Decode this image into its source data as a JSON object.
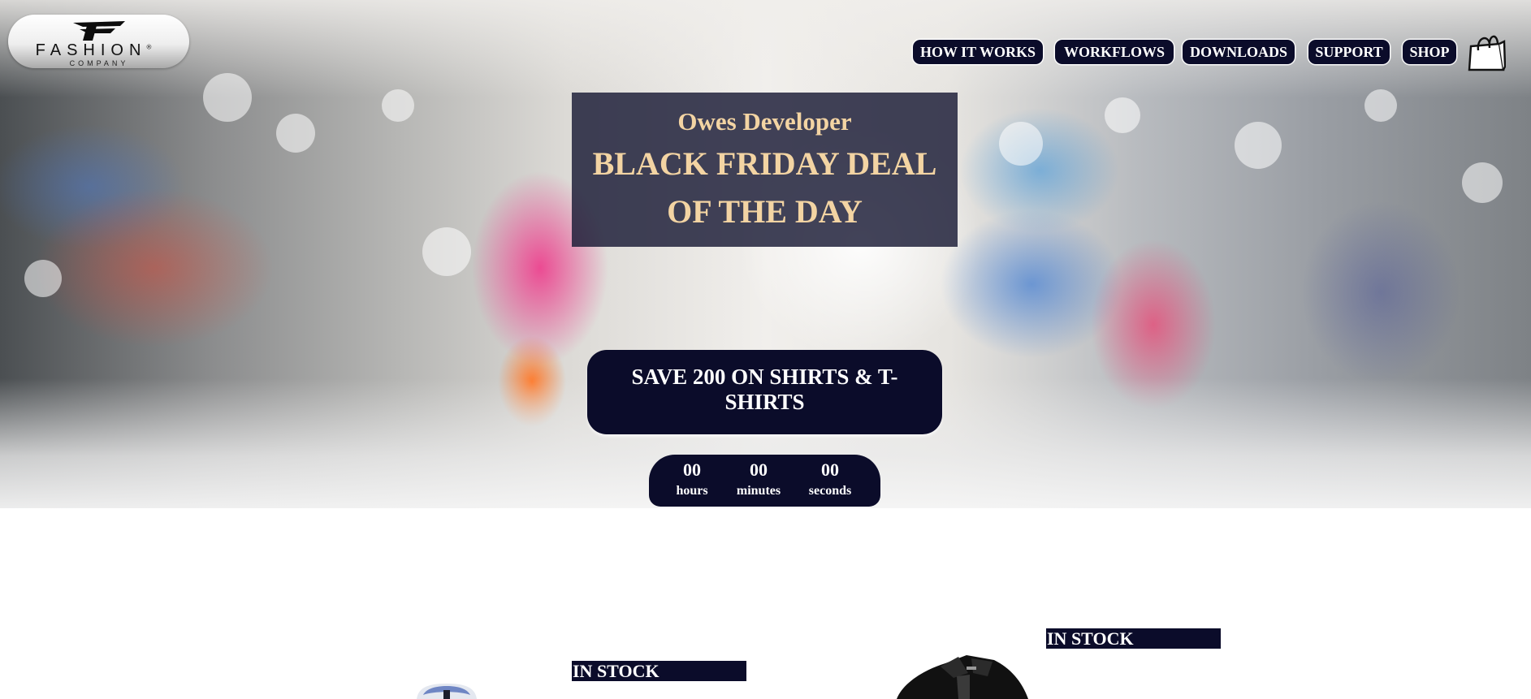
{
  "logo": {
    "wordmark": "FASHION",
    "registered": "®",
    "subtitle": "COMPANY"
  },
  "nav": {
    "items": [
      {
        "label": "HOW IT WORKS"
      },
      {
        "label": "WORKFLOWS"
      },
      {
        "label": "DOWNLOADS"
      },
      {
        "label": "SUPPORT"
      },
      {
        "label": "SHOP"
      }
    ],
    "cart_icon": "shopping-bag-icon"
  },
  "hero": {
    "brand": "Owes Developer",
    "headline": "BLACK FRIDAY DEAL OF THE DAY",
    "cta_label": "SAVE 200 ON SHIRTS & T-SHIRTS",
    "countdown": {
      "hours": "00",
      "hours_label": "hours",
      "minutes": "00",
      "minutes_label": "minutes",
      "seconds": "00",
      "seconds_label": "seconds"
    }
  },
  "products": [
    {
      "badge": "IN STOCK",
      "image": "light-blue-shirt"
    },
    {
      "badge": "IN STOCK",
      "image": "black-shirt"
    }
  ],
  "colors": {
    "navy": "#0b0c2a",
    "headline_text": "#f3d4a3",
    "white": "#ffffff"
  }
}
